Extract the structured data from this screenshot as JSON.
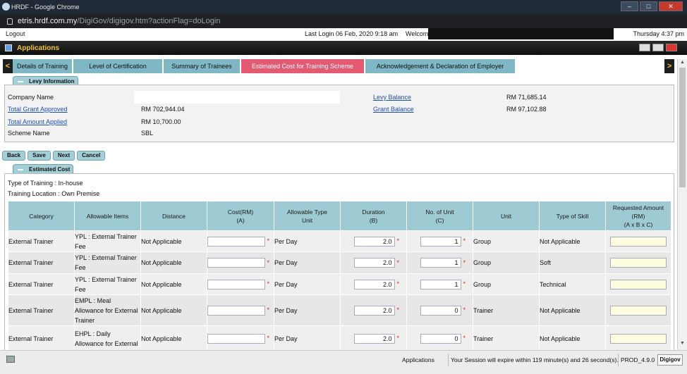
{
  "browser": {
    "title": "HRDF - Google Chrome",
    "url_host": "etris.hrdf.com.my",
    "url_path": "/DigiGov/digigov.htm?actionFlag=doLogin"
  },
  "infobar": {
    "logout": "Logout",
    "last_login": "Last Login 06 Feb, 2020 9:18 am",
    "welcome": "Welcom",
    "datetime": "Thursday 4:37 pm"
  },
  "appsbar": {
    "title": "Applications"
  },
  "tabs": {
    "prev": "<",
    "next": ">",
    "items": [
      {
        "label": "Details of Training"
      },
      {
        "label": "Level of Certification"
      },
      {
        "label": "Summary of Trainees"
      },
      {
        "label": "Estimated Cost for Training Scheme"
      },
      {
        "label": "Acknowledgement & Declaration of Employer"
      }
    ]
  },
  "levy": {
    "section_title": "Levy Information",
    "company_name_label": "Company Name",
    "total_grant_label": "Total Grant Approved",
    "total_grant_value": "RM 702,944.04",
    "total_applied_label": "Total Amount Applied",
    "total_applied_value": "RM 10,700.00",
    "scheme_label": "Scheme Name",
    "scheme_value": "SBL",
    "levy_balance_label": "Levy Balance",
    "levy_balance_value": "RM 71,685.14",
    "grant_balance_label": "Grant Balance",
    "grant_balance_value": "RM 97,102.88"
  },
  "buttons": {
    "back": "Back",
    "save": "Save",
    "next": "Next",
    "cancel": "Cancel"
  },
  "estimated": {
    "section_title": "Estimated Cost",
    "type_of_training": "Type of Training : In-house",
    "training_location": "Training Location : Own Premise",
    "headers": {
      "category": "Category",
      "allowable_items": "Allowable Items",
      "distance": "Distance",
      "cost_l1": "Cost(RM)",
      "cost_l2": "(A)",
      "allow_type_l1": "Allowable Type",
      "allow_type_l2": "Unit",
      "duration_l1": "Duration",
      "duration_l2": "(B)",
      "no_unit_l1": "No. of Unit",
      "no_unit_l2": "(C)",
      "unit": "Unit",
      "type_skill": "Type of Skill",
      "req_l1": "Requested Amount",
      "req_l2": "(RM)",
      "req_l3": "(A x B x C)"
    },
    "rows": [
      {
        "category": "External Trainer",
        "item": "YPL : External Trainer Fee",
        "distance": "Not Applicable",
        "cost": "",
        "allow_type": "Per Day",
        "duration": "2.0",
        "no_unit": "1",
        "unit": "Group",
        "skill": "Not Applicable"
      },
      {
        "category": "External Trainer",
        "item": "YPL : External Trainer Fee",
        "distance": "Not Applicable",
        "cost": "",
        "allow_type": "Per Day",
        "duration": "2.0",
        "no_unit": "1",
        "unit": "Group",
        "skill": "Soft"
      },
      {
        "category": "External Trainer",
        "item": "YPL : External Trainer Fee",
        "distance": "Not Applicable",
        "cost": "",
        "allow_type": "Per Day",
        "duration": "2.0",
        "no_unit": "1",
        "unit": "Group",
        "skill": "Technical"
      },
      {
        "category": "External Trainer",
        "item": "EMPL : Meal Allowance for External Trainer",
        "distance": "Not Applicable",
        "cost": "",
        "allow_type": "Per Day",
        "duration": "2.0",
        "no_unit": "0",
        "unit": "Trainer",
        "skill": "Not Applicable"
      },
      {
        "category": "External Trainer",
        "item": "EHPL : Daily Allowance for External",
        "distance": "Not Applicable",
        "cost": "",
        "allow_type": "Per Day",
        "duration": "2.0",
        "no_unit": "0",
        "unit": "Trainer",
        "skill": "Not Applicable"
      }
    ]
  },
  "status": {
    "applications": "Applications",
    "session": "Your Session will expire within 119 minute(s) and 26 second(s).",
    "version": "PROD_4.9.0",
    "brand": "Digigov"
  }
}
